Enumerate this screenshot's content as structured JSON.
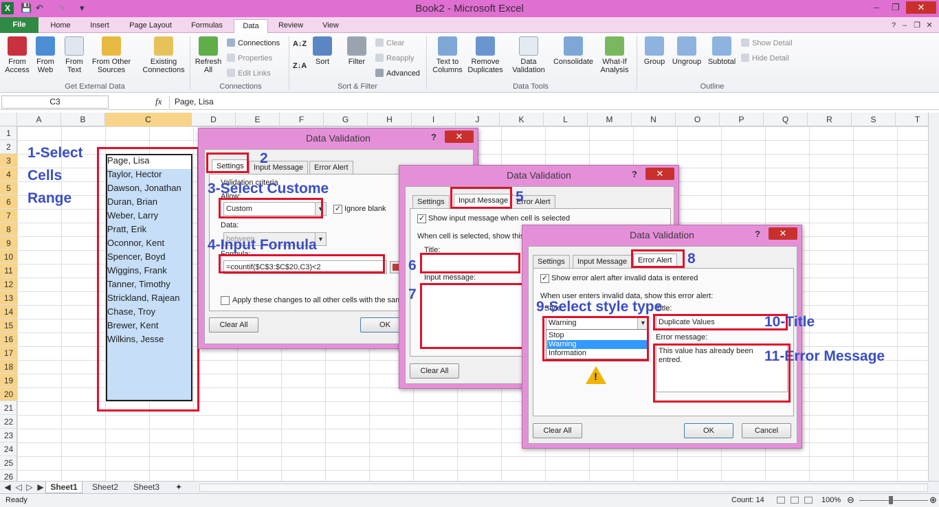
{
  "window": {
    "title": "Book2 - Microsoft Excel",
    "app_icon": "X"
  },
  "ribbon_tabs": [
    "File",
    "Home",
    "Insert",
    "Page Layout",
    "Formulas",
    "Data",
    "Review",
    "View"
  ],
  "ribbon": {
    "get_external_data": {
      "from_access": "From\nAccess",
      "from_web": "From\nWeb",
      "from_text": "From\nText",
      "from_other": "From Other\nSources",
      "existing": "Existing\nConnections",
      "group": "Get External Data"
    },
    "connections": {
      "refresh": "Refresh\nAll",
      "connections": "Connections",
      "properties": "Properties",
      "edit_links": "Edit Links",
      "group": "Connections"
    },
    "sort_filter": {
      "sort": "Sort",
      "filter": "Filter",
      "clear": "Clear",
      "reapply": "Reapply",
      "advanced": "Advanced",
      "group": "Sort & Filter"
    },
    "data_tools": {
      "text_to_columns": "Text to\nColumns",
      "remove_duplicates": "Remove\nDuplicates",
      "data_validation": "Data\nValidation",
      "consolidate": "Consolidate",
      "what_if": "What-If\nAnalysis",
      "group": "Data Tools"
    },
    "outline": {
      "group_btn": "Group",
      "ungroup": "Ungroup",
      "subtotal": "Subtotal",
      "show_detail": "Show Detail",
      "hide_detail": "Hide Detail",
      "group": "Outline"
    }
  },
  "formula_bar": {
    "name_box": "C3",
    "fx": "fx",
    "formula": "Page, Lisa"
  },
  "columns": [
    "A",
    "B",
    "C",
    "D",
    "E",
    "F",
    "G",
    "H",
    "I",
    "J",
    "K",
    "L",
    "M",
    "N",
    "O",
    "P",
    "Q",
    "R",
    "S",
    "T"
  ],
  "rows": [
    "1",
    "2",
    "3",
    "4",
    "5",
    "6",
    "7",
    "8",
    "9",
    "10",
    "11",
    "12",
    "13",
    "14",
    "15",
    "16",
    "17",
    "18",
    "19",
    "20",
    "21",
    "22",
    "23",
    "24",
    "25",
    "26"
  ],
  "cells_c": [
    "Page, Lisa",
    "Taylor, Hector",
    "Dawson, Jonathan",
    "Duran, Brian",
    "Weber, Larry",
    "Pratt, Erik",
    "Oconnor, Kent",
    "Spencer, Boyd",
    "Wiggins, Frank",
    "Tanner, Timothy",
    "Strickland, Rajean",
    "Chase, Troy",
    "Brewer, Kent",
    "Wilkins, Jesse"
  ],
  "annotations": {
    "a1a": "1-Select",
    "a1b": "Cells",
    "a1c": "Range",
    "a2": "2",
    "a3": "3-Select Custome",
    "a4": "4-Input Formula",
    "a5": "5",
    "a6": "6",
    "a7": "7",
    "a8": "8",
    "a9": "9-Select style type",
    "a10": "10-Title",
    "a11": "11-Error Message"
  },
  "dialog1": {
    "title": "Data Validation",
    "help": "?",
    "close": "✕",
    "tabs": [
      "Settings",
      "Input Message",
      "Error Alert"
    ],
    "validation_criteria": "Validation criteria",
    "allow_label": "Allow:",
    "allow_value": "Custom",
    "ignore_blank": "Ignore blank",
    "data_label": "Data:",
    "data_value": "between",
    "formula_label": "Formula:",
    "formula_value": "=countif($C$3:$C$20,C3)<2",
    "apply_changes": "Apply these changes to all other cells with the same s",
    "clear_all": "Clear All",
    "ok": "OK"
  },
  "dialog2": {
    "title": "Data Validation",
    "help": "?",
    "close": "✕",
    "tabs": [
      "Settings",
      "Input Message",
      "Error Alert"
    ],
    "show_input": "Show input message when cell is selected",
    "when_selected": "When cell is selected, show this i",
    "title_label": "Title:",
    "input_message_label": "Input message:",
    "clear_all": "Clear All"
  },
  "dialog3": {
    "title": "Data Validation",
    "help": "?",
    "close": "✕",
    "tabs": [
      "Settings",
      "Input Message",
      "Error Alert"
    ],
    "show_error": "Show error alert after invalid data is entered",
    "when_invalid": "When user enters invalid data, show this error alert:",
    "style_label": "Style:",
    "style_value": "Warning",
    "style_options": [
      "Stop",
      "Warning",
      "Information"
    ],
    "title_label": "Title:",
    "title_value": "Duplicate Values",
    "error_label": "Error message:",
    "error_value": "This value has already been entred.",
    "clear_all": "Clear All",
    "ok": "OK",
    "cancel": "Cancel"
  },
  "sheets": [
    "Sheet1",
    "Sheet2",
    "Sheet3"
  ],
  "status": {
    "ready": "Ready",
    "count": "Count: 14",
    "zoom": "100%"
  },
  "colors": {
    "title_bar": "#df6fd0",
    "annotation": "#3a4dc4",
    "highlight_box": "#e0102a",
    "selection": "#c6def7"
  }
}
